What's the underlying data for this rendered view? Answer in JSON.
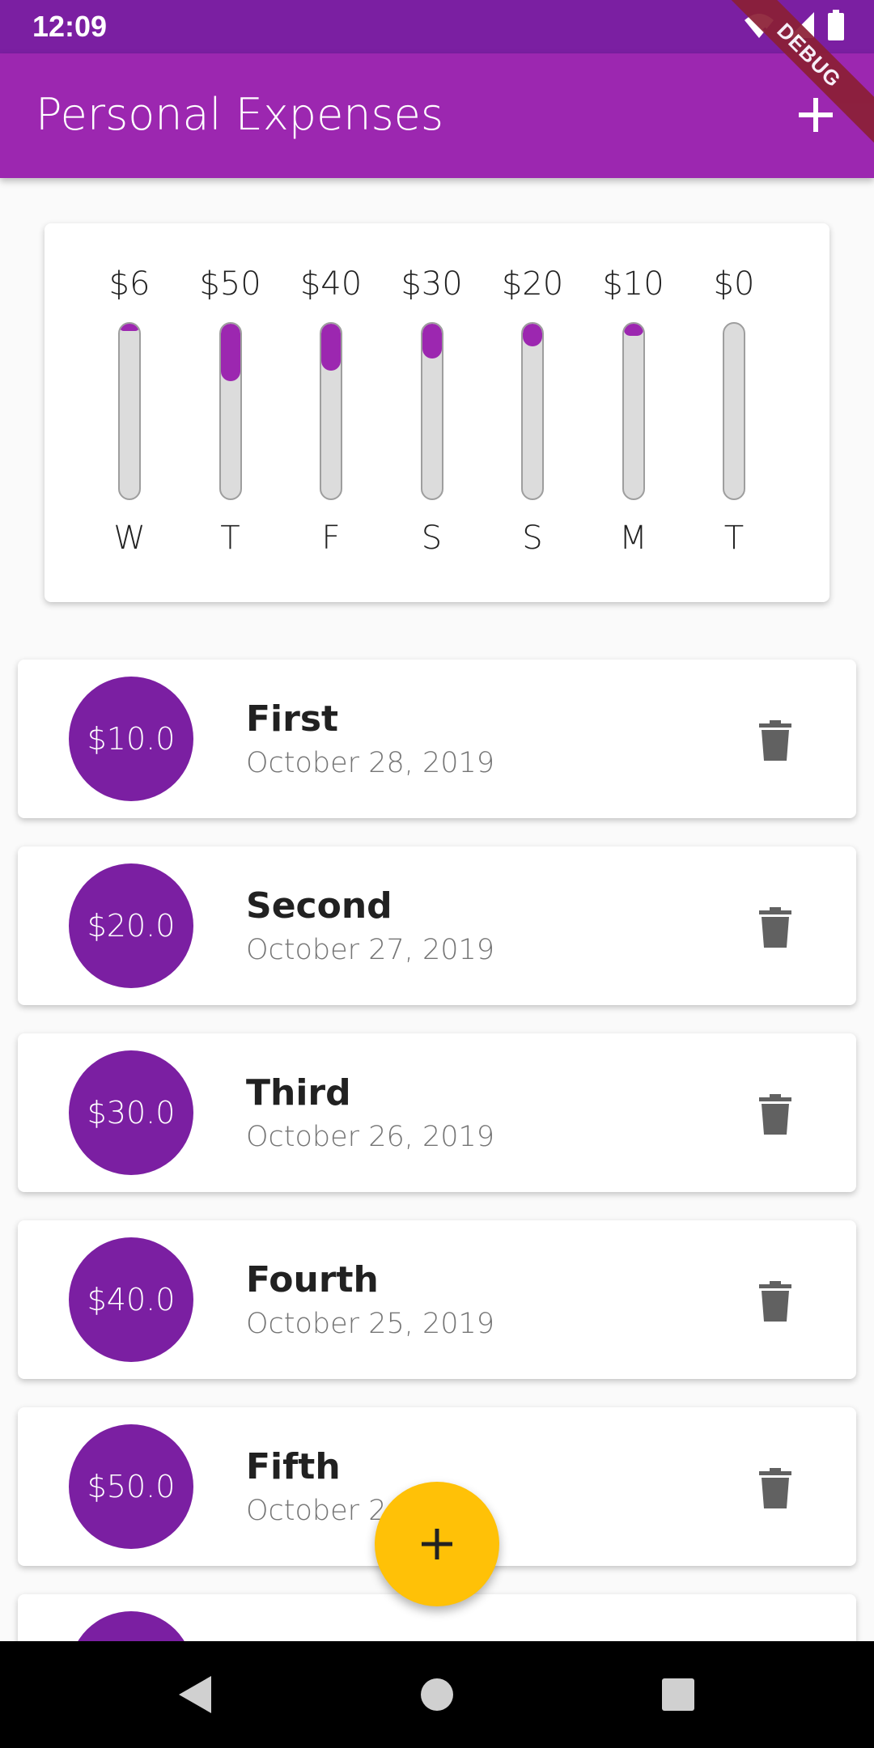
{
  "status_bar": {
    "time": "12:09",
    "icons": [
      "wifi-off-icon",
      "signal-icon",
      "battery-icon"
    ]
  },
  "debug_banner": "DEBUG",
  "app_bar": {
    "title": "Personal Expenses",
    "action_icon": "add-icon"
  },
  "chart_data": {
    "type": "bar",
    "categories": [
      "W",
      "T",
      "F",
      "S",
      "S",
      "M",
      "T"
    ],
    "values": [
      6,
      50,
      40,
      30,
      20,
      10,
      0
    ],
    "labels": [
      "$6",
      "$50",
      "$40",
      "$30",
      "$20",
      "$10",
      "$0"
    ],
    "fill_fraction": [
      0.04,
      0.33,
      0.27,
      0.2,
      0.13,
      0.07,
      0
    ],
    "title": "",
    "xlabel": "",
    "ylabel": ""
  },
  "transactions": [
    {
      "amount": "$10.0",
      "title": "First",
      "date": "October 28, 2019"
    },
    {
      "amount": "$20.0",
      "title": "Second",
      "date": "October 27, 2019"
    },
    {
      "amount": "$30.0",
      "title": "Third",
      "date": "October 26, 2019"
    },
    {
      "amount": "$40.0",
      "title": "Fourth",
      "date": "October 25, 2019"
    },
    {
      "amount": "$50.0",
      "title": "Fifth",
      "date": "October 2"
    }
  ],
  "fab": {
    "icon": "add-icon"
  },
  "colors": {
    "primary": "#9c27b0",
    "primary_dark": "#7b1fa2",
    "accent": "#ffc107"
  },
  "nav_bar": {
    "icons": [
      "back-icon",
      "home-icon",
      "recents-icon"
    ]
  }
}
